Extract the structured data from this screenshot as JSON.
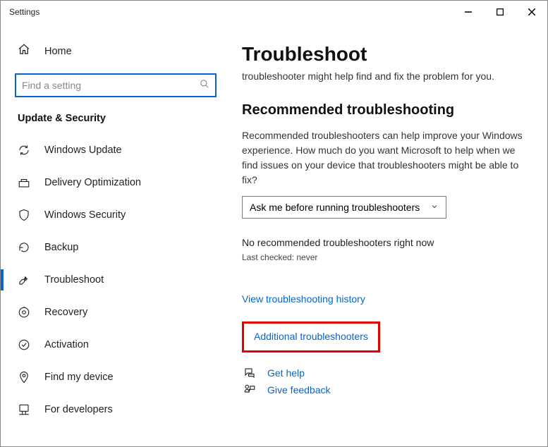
{
  "window": {
    "title": "Settings"
  },
  "sidebar": {
    "home_label": "Home",
    "search_placeholder": "Find a setting",
    "section_title": "Update & Security",
    "items": [
      {
        "label": "Windows Update"
      },
      {
        "label": "Delivery Optimization"
      },
      {
        "label": "Windows Security"
      },
      {
        "label": "Backup"
      },
      {
        "label": "Troubleshoot"
      },
      {
        "label": "Recovery"
      },
      {
        "label": "Activation"
      },
      {
        "label": "Find my device"
      },
      {
        "label": "For developers"
      }
    ]
  },
  "content": {
    "title": "Troubleshoot",
    "intro": "troubleshooter might help find and fix the problem for you.",
    "rec_heading": "Recommended troubleshooting",
    "rec_text": "Recommended troubleshooters can help improve your Windows experience. How much do you want Microsoft to help when we find issues on your device that troubleshooters might be able to fix?",
    "dropdown_value": "Ask me before running troubleshooters",
    "status_line": "No recommended troubleshooters right now",
    "last_checked": "Last checked: never",
    "history_link": "View troubleshooting history",
    "additional_link": "Additional troubleshooters",
    "get_help": "Get help",
    "give_feedback": "Give feedback"
  }
}
